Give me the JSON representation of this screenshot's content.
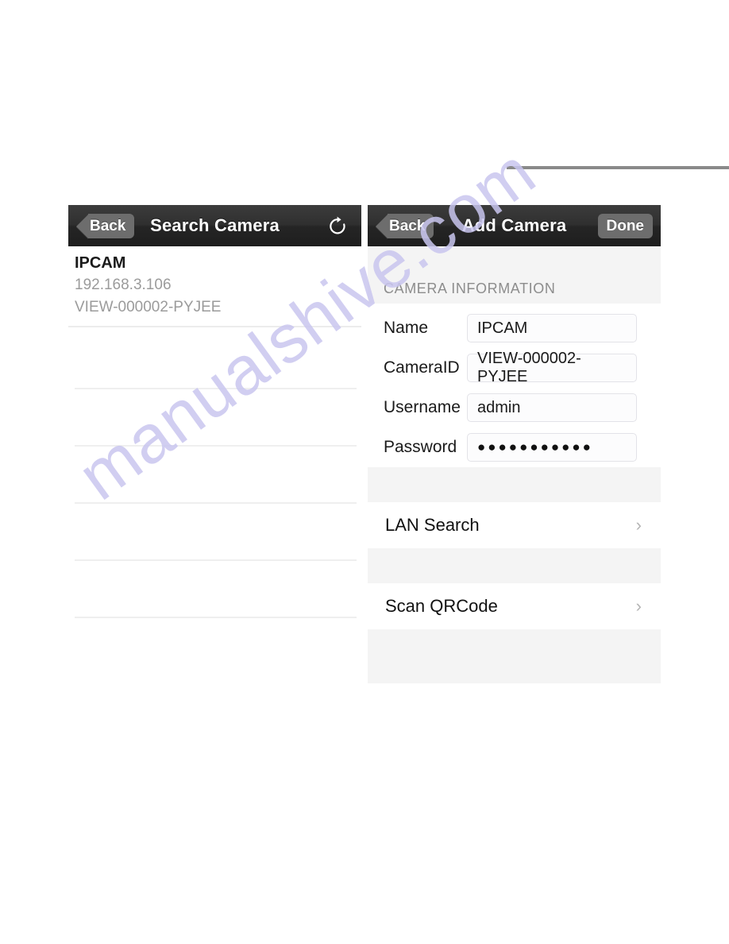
{
  "watermark": {
    "text": "manualshive.com"
  },
  "left_panel": {
    "navbar": {
      "back_label": "Back",
      "title": "Search Camera",
      "refresh_icon": "refresh-icon"
    },
    "results": [
      {
        "name": "IPCAM",
        "ip": "192.168.3.106",
        "uid": "VIEW-000002-PYJEE"
      }
    ],
    "empty_row_count": 6
  },
  "right_panel": {
    "navbar": {
      "back_label": "Back",
      "title": "Add Camera",
      "done_label": "Done"
    },
    "section_title": "CAMERA INFORMATION",
    "fields": [
      {
        "label": "Name",
        "value": "IPCAM",
        "masked": false
      },
      {
        "label": "CameraID",
        "value": "VIEW-000002-PYJEE",
        "masked": false
      },
      {
        "label": "Username",
        "value": "admin",
        "masked": false
      },
      {
        "label": "Password",
        "value": "●●●●●●●●●●●",
        "masked": true
      }
    ],
    "menu_items": [
      {
        "label": "LAN Search",
        "chevron": "›"
      },
      {
        "label": "Scan QRCode",
        "chevron": "›"
      }
    ]
  }
}
